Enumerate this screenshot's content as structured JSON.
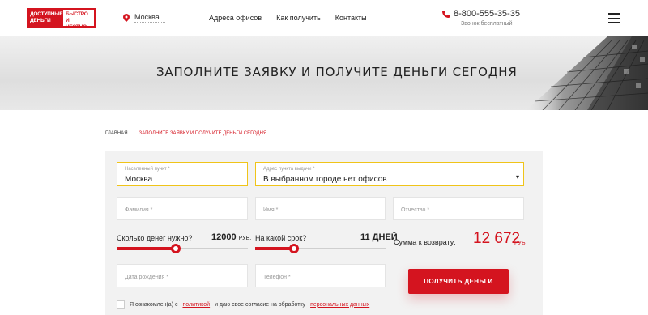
{
  "header": {
    "logo": {
      "left_text": "ДОСТУПНЫЕ ДЕНЬГИ",
      "right_text": "БЫСТРО И ЧЕСТНО"
    },
    "city": "Москва",
    "nav": [
      "Адреса офисов",
      "Как получить",
      "Контакты"
    ],
    "phone": "8-800-555-35-35",
    "phone_sub": "Звонок бесплатный"
  },
  "banner": {
    "title": "ЗАПОЛНИТЕ ЗАЯВКУ И ПОЛУЧИТЕ ДЕНЬГИ СЕГОДНЯ"
  },
  "breadcrumb": {
    "home": "ГЛАВНАЯ",
    "arrow": "→",
    "current": "ЗАПОЛНИТЕ ЗАЯВКУ И ПОЛУЧИТЕ ДЕНЬГИ СЕГОДНЯ"
  },
  "form": {
    "city": {
      "label": "Населенный пункт *",
      "value": "Москва"
    },
    "office": {
      "label": "Адрес пункта выдачи *",
      "value": "В выбранном городе нет офисов"
    },
    "surname": {
      "placeholder": "Фамилия *"
    },
    "name": {
      "placeholder": "Имя *"
    },
    "patronymic": {
      "placeholder": "Отчество *"
    },
    "amount": {
      "label": "Сколько денег нужно?",
      "value": "12000",
      "unit": "РУБ.",
      "level": 0.45
    },
    "term": {
      "label": "На какой срок?",
      "value": "11 ДНЕЙ",
      "level": 0.3
    },
    "sum": {
      "label": "Сумма к возврату:",
      "value": "12 672",
      "unit": "РУБ."
    },
    "birthdate": {
      "placeholder": "Дата рождения *"
    },
    "phone": {
      "placeholder": "Телефон *"
    },
    "submit": "ПОЛУЧИТЬ ДЕНЬГИ",
    "agree": {
      "prefix": "Я ознакомлен(а) с",
      "policy_link": "политикой",
      "middle": "и даю свое согласие на обработку",
      "data_link": "персональных данных"
    }
  },
  "colors": {
    "accent": "#d4141f",
    "highlight_border": "#f0c419"
  }
}
